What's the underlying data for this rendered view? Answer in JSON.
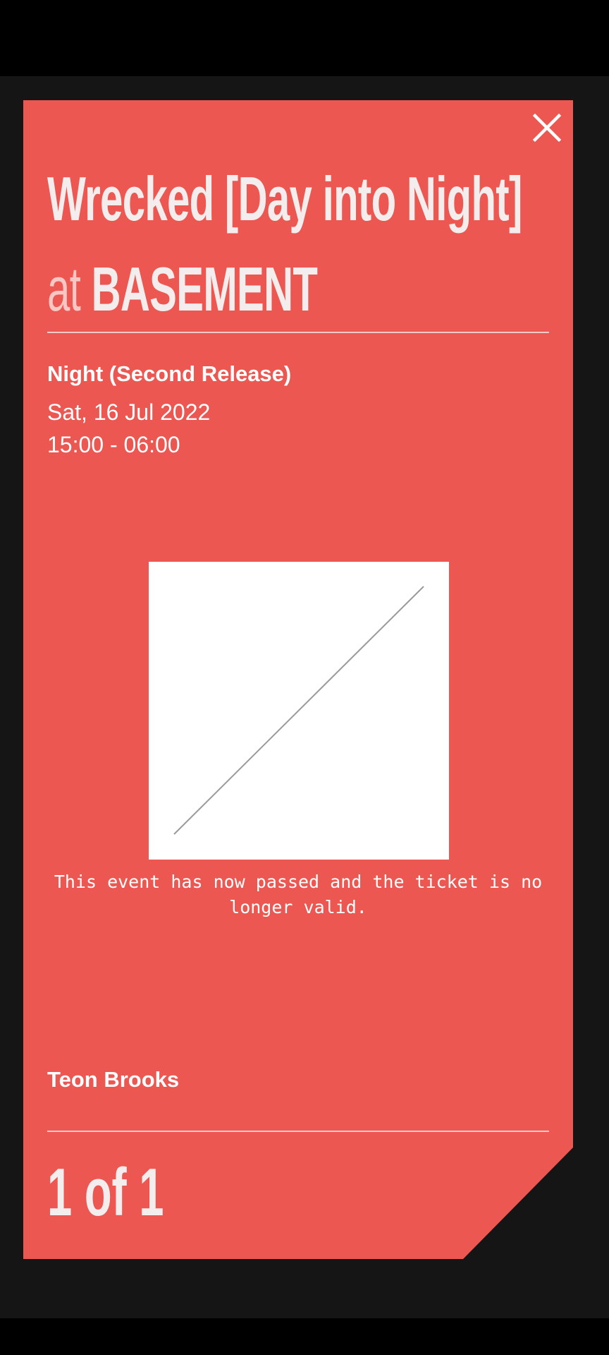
{
  "ticket": {
    "event_name": "Wrecked [Day into Night]",
    "at_word": "at",
    "venue": "BASEMENT",
    "ticket_type": "Night (Second Release)",
    "date": "Sat, 16 Jul 2022",
    "time": "15:00 - 06:00",
    "notice": "This event has now passed and the ticket is no longer valid.",
    "holder_name": "Teon Brooks",
    "count": "1 of 1"
  },
  "icons": {
    "close": "close-icon",
    "code": "broken-code-image"
  },
  "colors": {
    "ticket_bg": "#EC5752",
    "app_bg": "#151515",
    "title_text": "#F3EDED",
    "accent_text": "#F7C7C3",
    "divider": "#F6C9C6"
  }
}
